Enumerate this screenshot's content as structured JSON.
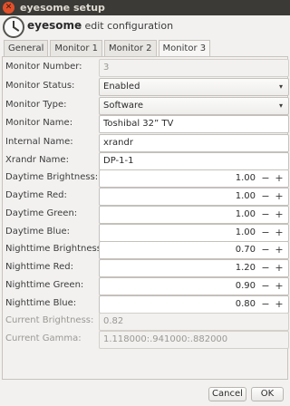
{
  "window": {
    "title": "eyesome setup",
    "close_icon": "close-icon"
  },
  "header": {
    "brand": "eyesome",
    "subtitle": "- edit configuration"
  },
  "tabs": [
    {
      "label": "General"
    },
    {
      "label": "Monitor 1"
    },
    {
      "label": "Monitor 2"
    },
    {
      "label": "Monitor 3",
      "active": true
    }
  ],
  "form": {
    "monitor_number": {
      "label": "Monitor Number:",
      "value": "3"
    },
    "monitor_status": {
      "label": "Monitor Status:",
      "value": "Enabled"
    },
    "monitor_type": {
      "label": "Monitor Type:",
      "value": "Software"
    },
    "monitor_name": {
      "label": "Monitor Name:",
      "value": "Toshibal 32” TV"
    },
    "internal_name": {
      "label": "Internal Name:",
      "value": "xrandr"
    },
    "xrandr_name": {
      "label": "Xrandr Name:",
      "value": "DP-1-1"
    },
    "daytime_brightness": {
      "label": "Daytime Brightness:",
      "value": "1.00"
    },
    "daytime_red": {
      "label": "Daytime Red:",
      "value": "1.00"
    },
    "daytime_green": {
      "label": "Daytime Green:",
      "value": "1.00"
    },
    "daytime_blue": {
      "label": "Daytime Blue:",
      "value": "1.00"
    },
    "nighttime_brightness": {
      "label": "Nighttime Brightness:",
      "value": "0.70"
    },
    "nighttime_red": {
      "label": "Nighttime Red:",
      "value": "1.20"
    },
    "nighttime_green": {
      "label": "Nighttime Green:",
      "value": "0.90"
    },
    "nighttime_blue": {
      "label": "Nighttime Blue:",
      "value": "0.80"
    },
    "current_brightness": {
      "label": "Current Brightness:",
      "value": "0.82"
    },
    "current_gamma": {
      "label": "Current Gamma:",
      "value": "1.118000:.941000:.882000"
    }
  },
  "spin": {
    "minus": "−",
    "plus": "+"
  },
  "combo_arrow": "▾",
  "buttons": {
    "cancel": "Cancel",
    "ok": "OK"
  }
}
